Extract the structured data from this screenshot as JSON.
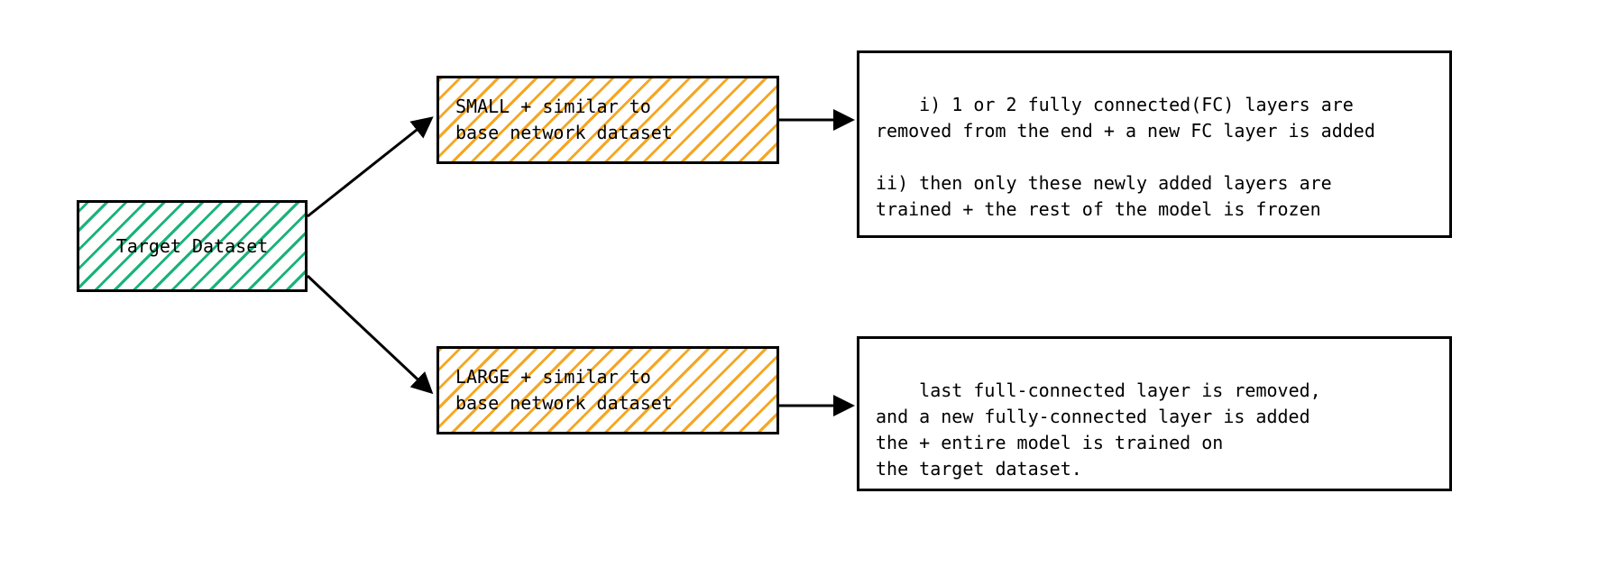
{
  "root": {
    "label": "Target Dataset"
  },
  "branch_small": {
    "label": "SMALL + similar to\nbase network dataset",
    "result": "i) 1 or 2 fully connected(FC) layers are\nremoved from the end + a new FC layer is added\n\nii) then only these newly added layers are\ntrained + the rest of the model is frozen"
  },
  "branch_large": {
    "label": "LARGE + similar to\nbase network dataset",
    "result": "last full-connected layer is removed,\nand a new fully-connected layer is added\nthe + entire model is trained on\nthe target dataset."
  }
}
